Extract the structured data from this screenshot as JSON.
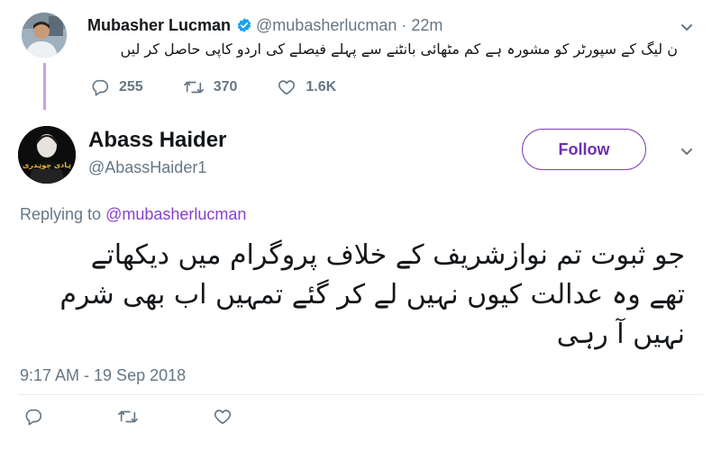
{
  "parent_tweet": {
    "name": "Mubasher Lucman",
    "verified_icon": "verified-badge-icon",
    "handle": "@mubasherlucman",
    "separator": "·",
    "time": "22m",
    "text": "ن لیگ کے سپورٹر کو مشورہ ہے کم مٹھائی بانٹنے سے پہلے فیصلے کی اردو کاپی حاصل کر لیں",
    "actions": {
      "replies": "255",
      "retweets": "370",
      "likes": "1.6K"
    }
  },
  "main_tweet": {
    "name": "Abass Haider",
    "handle": "@AbassHaider1",
    "avatar_text": "ہادی چوہدری",
    "follow_label": "Follow",
    "replying_prefix": "Replying to",
    "replying_handle": "@mubasherlucman",
    "text": "جو ثبوت تم نوازشریف کے خلاف پروگرام میں دیکھاتے تھے وہ عدالت کیوں نہیں لے کر گئے تمہیں اب بھی شرم نہیں آ رہی",
    "timestamp": "9:17 AM - 19 Sep 2018"
  },
  "colors": {
    "accent": "#7b3fb8",
    "thread_line": "#c5a1e8",
    "verified": "#1da1f2",
    "muted_text": "#657786"
  }
}
